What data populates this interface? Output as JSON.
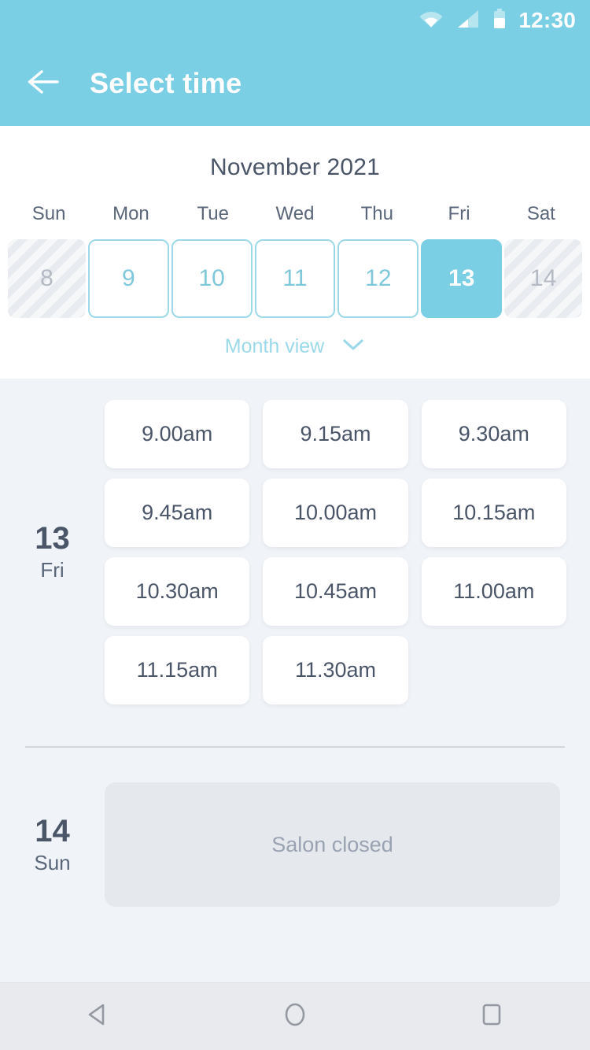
{
  "status_bar": {
    "time": "12:30",
    "icons": [
      "wifi-icon",
      "signal-icon",
      "battery-icon"
    ]
  },
  "app_bar": {
    "back_icon": "arrow-left-icon",
    "title": "Select time"
  },
  "calendar": {
    "month_label": "November 2021",
    "weekdays": [
      "Sun",
      "Mon",
      "Tue",
      "Wed",
      "Thu",
      "Fri",
      "Sat"
    ],
    "days": [
      {
        "num": "8",
        "state": "disabled"
      },
      {
        "num": "9",
        "state": "available"
      },
      {
        "num": "10",
        "state": "available"
      },
      {
        "num": "11",
        "state": "available"
      },
      {
        "num": "12",
        "state": "available"
      },
      {
        "num": "13",
        "state": "selected"
      },
      {
        "num": "14",
        "state": "disabled"
      }
    ],
    "month_view_label": "Month view",
    "month_view_icon": "chevron-down-icon"
  },
  "schedule": [
    {
      "day_number": "13",
      "day_name": "Fri",
      "type": "slots",
      "slots": [
        "9.00am",
        "9.15am",
        "9.30am",
        "9.45am",
        "10.00am",
        "10.15am",
        "10.30am",
        "10.45am",
        "11.00am",
        "11.15am",
        "11.30am"
      ]
    },
    {
      "day_number": "14",
      "day_name": "Sun",
      "type": "closed",
      "closed_label": "Salon closed"
    }
  ],
  "nav_bar": {
    "back_icon": "nav-back-triangle-icon",
    "home_icon": "nav-home-circle-icon",
    "recents_icon": "nav-recents-square-icon"
  },
  "colors": {
    "accent": "#7ACFE4",
    "accent_light": "#9BD9E8",
    "background": "#F0F3F7",
    "panel": "#FFFFFF",
    "text_dark": "#4A5568",
    "text_muted": "#9AA3B2",
    "closed_box": "#E5E8ED"
  }
}
